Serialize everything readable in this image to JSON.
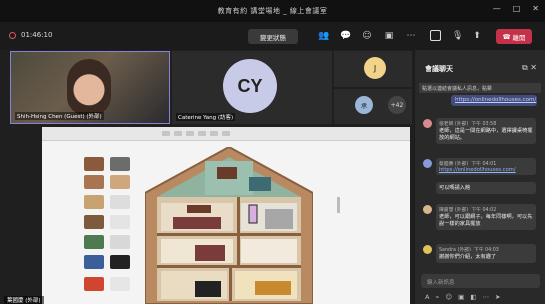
{
  "window": {
    "title": "教育有約 講堂場地 _ 線上會議室"
  },
  "callbar": {
    "timer": "01:46:10",
    "status_button": "變更狀態",
    "leave_label": "離開"
  },
  "participants": {
    "video_tile_label": "Shih-Hsing Chen (Guest) (外部)",
    "cy_initials": "CY",
    "cy_label": "Caterine Yang (訪客)",
    "j_initials": "J",
    "small_initials": "承",
    "more_count": "+42",
    "presenter_label": "葉國慶 (外部)"
  },
  "chat": {
    "title": "會議聊天",
    "pinned_text": "點選以連結會議私人訊息，點擊",
    "top_link": "https://onlinedollhouses.com/",
    "messages": [
      {
        "sender": "張老師 (外部)",
        "time": "下午 03:58",
        "text": "老師，這是一間在網路中，選擇課桌椅擺放的網站。",
        "link": "",
        "avatar_color": "#d98a8a"
      },
      {
        "sender": "蔡國勝 (外部)",
        "time": "下午 04:01",
        "text": "",
        "link": "https://onlinedollhouses.com/",
        "avatar_color": "#8a9ad9"
      },
      {
        "sender": "",
        "time": "",
        "text": "可以嗎請入館",
        "link": "",
        "avatar_color": ""
      },
      {
        "sender": "陳嘉慧 (外部)",
        "time": "下午 04:02",
        "text": "老師，可以跟網子，每年同樣啊，可以先說一樣的家具擺放",
        "link": "",
        "avatar_color": "#d9b68a"
      },
      {
        "sender": "Sandra (外部)",
        "time": "下午 04:03",
        "text": "謝謝你們介紹，太有趣了",
        "link": "",
        "avatar_color": "#e0c15a"
      }
    ],
    "compose_placeholder": "鍵入新訊息"
  }
}
